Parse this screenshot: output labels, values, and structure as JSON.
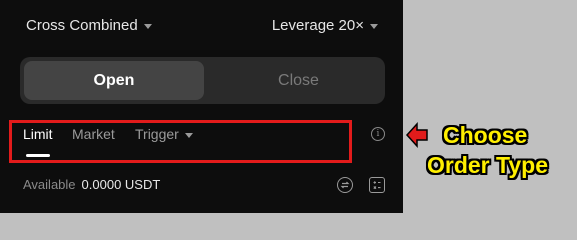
{
  "header": {
    "margin_mode": "Cross Combined",
    "leverage": "Leverage 20×"
  },
  "position_toggle": {
    "open_label": "Open",
    "close_label": "Close",
    "selected": "Open"
  },
  "order_types": {
    "tabs": [
      {
        "label": "Limit",
        "active": true
      },
      {
        "label": "Market",
        "active": false
      },
      {
        "label": "Trigger",
        "active": false,
        "has_dropdown": true
      }
    ],
    "info_icon": "info-icon"
  },
  "balance": {
    "label": "Available",
    "value": "0.0000 USDT"
  },
  "annotation": {
    "line1": "Choose",
    "line2": "Order Type",
    "text_color": "#ffef00",
    "box_color": "#e21b1b"
  }
}
